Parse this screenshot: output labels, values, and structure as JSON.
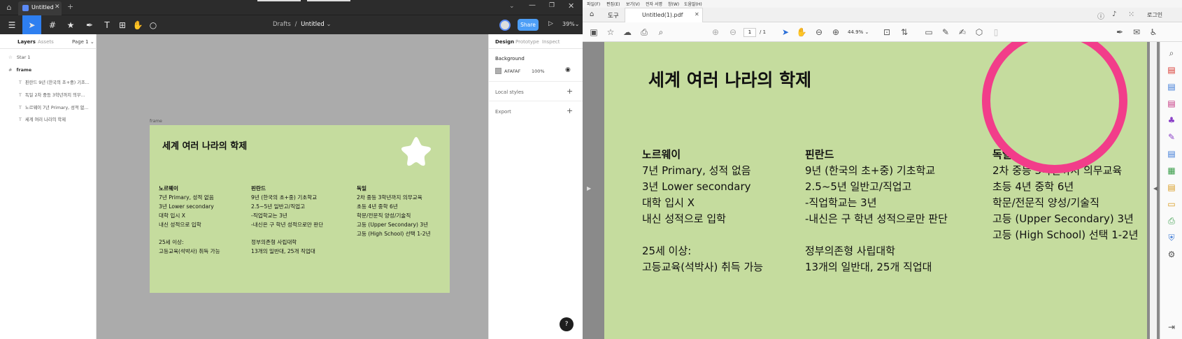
{
  "figma": {
    "tab_title": "Untitled",
    "breadcrumb_drafts": "Drafts",
    "breadcrumb_sep": "/",
    "breadcrumb_file": "Untitled",
    "share_label": "Share",
    "zoom_label": "39%",
    "left_panel": {
      "tab_layers": "Layers",
      "tab_assets": "Assets",
      "page_label": "Page 1",
      "layers": [
        "Star 1",
        "frame",
        "핀란드 9년 (한국의 초+중) 기초...",
        "독일 2차 중등 3학년까지 의무...",
        "노르웨이 7년 Primary, 성적 없...",
        "세계 여러 나라의 학제"
      ]
    },
    "right_panel": {
      "tab_design": "Design",
      "tab_prototype": "Prototype",
      "tab_inspect": "Inspect",
      "background_label": "Background",
      "bg_hex": "AFAFAF",
      "bg_opacity": "100%",
      "local_styles": "Local styles",
      "export": "Export"
    },
    "frame_label": "frame",
    "help_label": "?"
  },
  "slide": {
    "title": "세계 여러 나라의 학제",
    "columns": [
      {
        "heading": "노르웨이",
        "lines": [
          "7년 Primary, 성적 없음",
          "3년 Lower secondary",
          "대학 입시 X",
          "내신 성적으로 입학",
          "",
          "25세 이상:",
          "고등교육(석박사) 취득 가능"
        ]
      },
      {
        "heading": "핀란드",
        "lines": [
          "9년 (한국의 초+중) 기초학교",
          "2.5~5년 일반고/직업고",
          "-직업학교는 3년",
          "-내신은 구 학년 성적으로만 판단",
          "",
          "정부의존형 사립대학",
          "13개의 일반대, 25개 직업대"
        ]
      },
      {
        "heading": "독일",
        "lines": [
          "2차 중등 3학년까지 의무교육",
          "초등 4년 중학 6년",
          "학문/전문직 양성/기술직",
          "고등 (Upper Secondary) 3년",
          "고등 (High School) 선택 1-2년"
        ]
      }
    ]
  },
  "acrobat": {
    "menu": [
      "파일(F)",
      "편집(E)",
      "보기(V)",
      "전자 서명",
      "창(W)",
      "도움말(H)"
    ],
    "home_tab": "도구",
    "file_tab": "Untitled(1).pdf",
    "login": "로그인",
    "page_current": "1",
    "page_total": "/ 1",
    "zoom": "44.9%"
  },
  "colors": {
    "slide_bg": "#c5dc9e",
    "figma_share": "#4d9ef6",
    "figma_select": "#2e7ff0",
    "annotation_circle": "#f23d8a"
  }
}
